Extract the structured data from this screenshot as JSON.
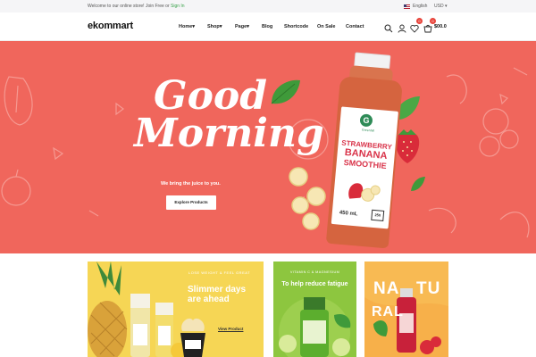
{
  "topbar": {
    "welcome_text": "Welcome to our online store! Join Free or",
    "signin_label": "Sign In",
    "language": "English",
    "currency": "USD"
  },
  "header": {
    "logo": "ekommart",
    "nav": [
      "Home",
      "Shop",
      "Page",
      "Blog",
      "Shortcode",
      "On Sale",
      "Contact"
    ],
    "wishlist_count": "0",
    "cart_count": "0",
    "cart_total": "$00.0"
  },
  "hero": {
    "script_line1": "Good",
    "script_line2": "Morning",
    "subtitle": "We bring the juice to you.",
    "cta_label": "Explore Products",
    "bottle": {
      "brand": "Greenhill",
      "title_line1": "STRAWBERRY",
      "title_line2": "BANANA",
      "title_line3": "SMOOTHIE",
      "volume": "450 mL",
      "nutrition_badge": "250"
    }
  },
  "banners": [
    {
      "kicker": "LOSE WEIGHT & FEEL GREAT",
      "title": "Slimmer days are ahead",
      "link_label": "View Product"
    },
    {
      "kicker": "VITAMIN C & MAGNESIUM",
      "title": "To help reduce fatigue"
    },
    {
      "word": "NATURAL"
    }
  ],
  "colors": {
    "hero_bg": "#f0665c",
    "banner1_bg": "#f6d655",
    "banner2_bg": "#8dc63f",
    "banner3_bg": "#f8a64a",
    "accent_green": "#3aa34b",
    "badge_red": "#e8453c"
  }
}
